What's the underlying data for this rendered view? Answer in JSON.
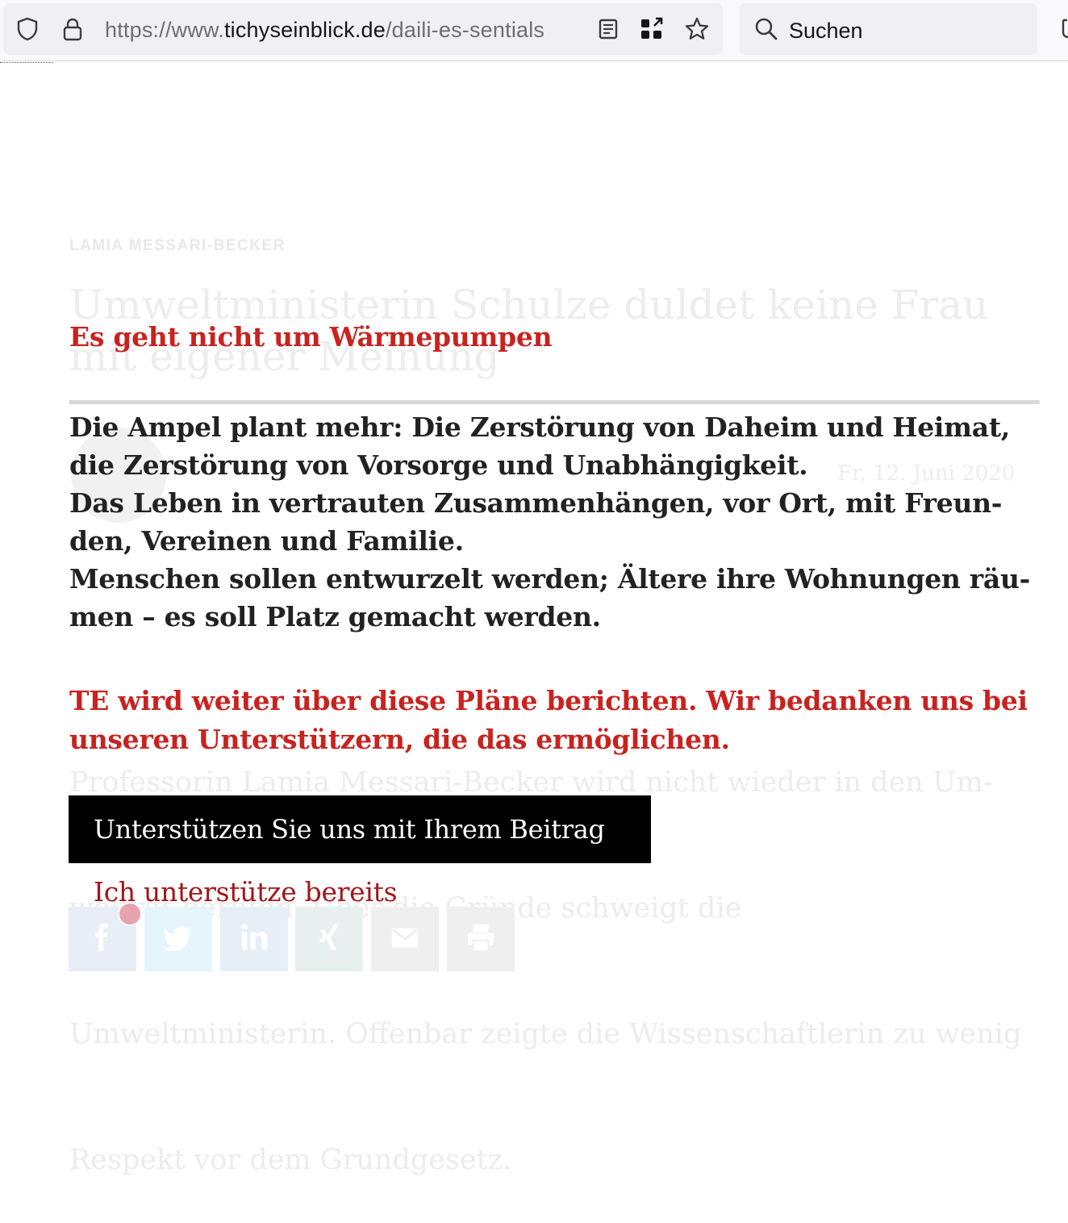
{
  "browser": {
    "url_scheme": "https://www.",
    "url_domain": "tichyseinblick.de",
    "url_path": "/daili-es-sentials",
    "search_placeholder": "Suchen",
    "icons": [
      "shield-icon",
      "lock-icon",
      "reader-view-icon",
      "extensions-grid-icon",
      "bookmark-star-icon",
      "search-icon"
    ]
  },
  "background_article": {
    "author": "LAMIA MESSARI-BECKER",
    "headline": "Umweltministerin Schulze duldet keine Frau mit eigener Meinung",
    "date": "Fr, 12. Juni 2020",
    "body_lines": [
      "Professorin Lamia Messari-Becker wird nicht wieder in den Um-",
      "weltrat berufen. Über die Gründe schweigt die",
      "Umweltministerin. Offenbar zeigte die Wissenschaftlerin zu wenig",
      "Respekt vor dem Grundgesetz."
    ]
  },
  "overlay": {
    "title": "Es geht nicht um Wärmepumpen",
    "lead_lines": [
      "Die Ampel plant mehr: Die Zerstörung von Daheim und Heimat,",
      "die Zerstörung von Vorsorge und Unabhängigkeit.",
      "Das Leben in vertrauten Zusammenhängen, vor Ort, mit Freun-",
      "den, Vereinen und Familie.",
      "Menschen sollen entwurzelt werden; Ältere ihre Wohnungen räu-",
      "men – es soll Platz gemacht werden."
    ],
    "thanks_lines": [
      "TE wird weiter über diese Pläne berichten. Wir bedanken uns bei",
      "unseren Unterstützern, die das ermöglichen."
    ],
    "cta_label": "Unterstützen Sie uns mit Ihrem Beitrag",
    "already_label": "Ich unterstütze bereits"
  },
  "share_bar": {
    "items": [
      {
        "name": "facebook-icon",
        "color": "#e9edf5"
      },
      {
        "name": "twitter-icon",
        "color": "#e6f4fb"
      },
      {
        "name": "linkedin-icon",
        "color": "#e6eff6"
      },
      {
        "name": "xing-icon",
        "color": "#e8efef"
      },
      {
        "name": "email-icon",
        "color": "#efefef"
      },
      {
        "name": "print-icon",
        "color": "#efefef"
      }
    ]
  },
  "colors": {
    "accent_red": "#c8231f",
    "link_red": "#a5161a",
    "text_dark": "#222222",
    "cta_bg": "#000000"
  }
}
